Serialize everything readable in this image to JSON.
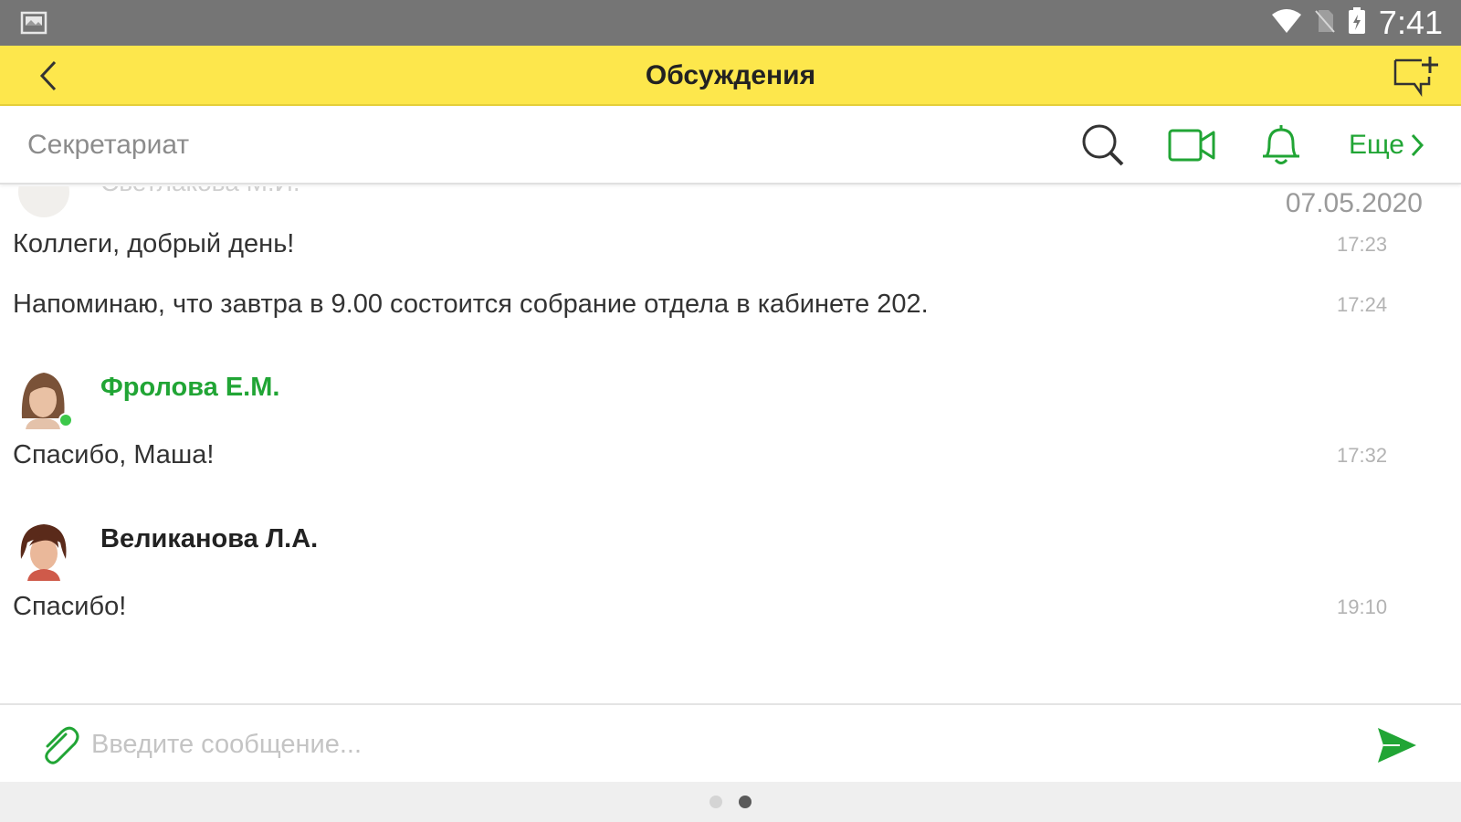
{
  "status_bar": {
    "time": "7:41",
    "icons": [
      "gallery-icon",
      "wifi-icon",
      "no-sim-icon",
      "battery-icon"
    ]
  },
  "app_bar": {
    "title": "Обсуждения",
    "back_icon": "chevron-left-icon",
    "new_icon": "new-discussion-icon"
  },
  "channel": {
    "name": "Секретариат",
    "more_label": "Еще",
    "tools": [
      "search-icon",
      "video-call-icon",
      "bell-icon"
    ]
  },
  "feed": {
    "date": "07.05.2020",
    "faded_author": "Светлакова М.И.",
    "groups": [
      {
        "author": "",
        "messages": [
          {
            "text": "Коллеги, добрый день!",
            "time": "17:23"
          },
          {
            "text": "Напоминаю, что завтра в 9.00 состоится собрание отдела в кабинете 202.",
            "time": "17:24"
          }
        ]
      },
      {
        "author": "Фролова Е.М.",
        "online": true,
        "messages": [
          {
            "text": "Спасибо, Маша!",
            "time": "17:32"
          }
        ]
      },
      {
        "author": "Великанова Л.А.",
        "online": false,
        "messages": [
          {
            "text": "Спасибо!",
            "time": "19:10"
          }
        ]
      }
    ]
  },
  "composer": {
    "placeholder": "Введите сообщение...",
    "attach_icon": "paperclip-icon",
    "send_icon": "send-icon"
  },
  "pager": {
    "pages": 2,
    "active": 2
  },
  "colors": {
    "accent_yellow": "#fde74c",
    "accent_green": "#21a535",
    "status_bar": "#757575",
    "online_dot": "#3cc84a"
  }
}
